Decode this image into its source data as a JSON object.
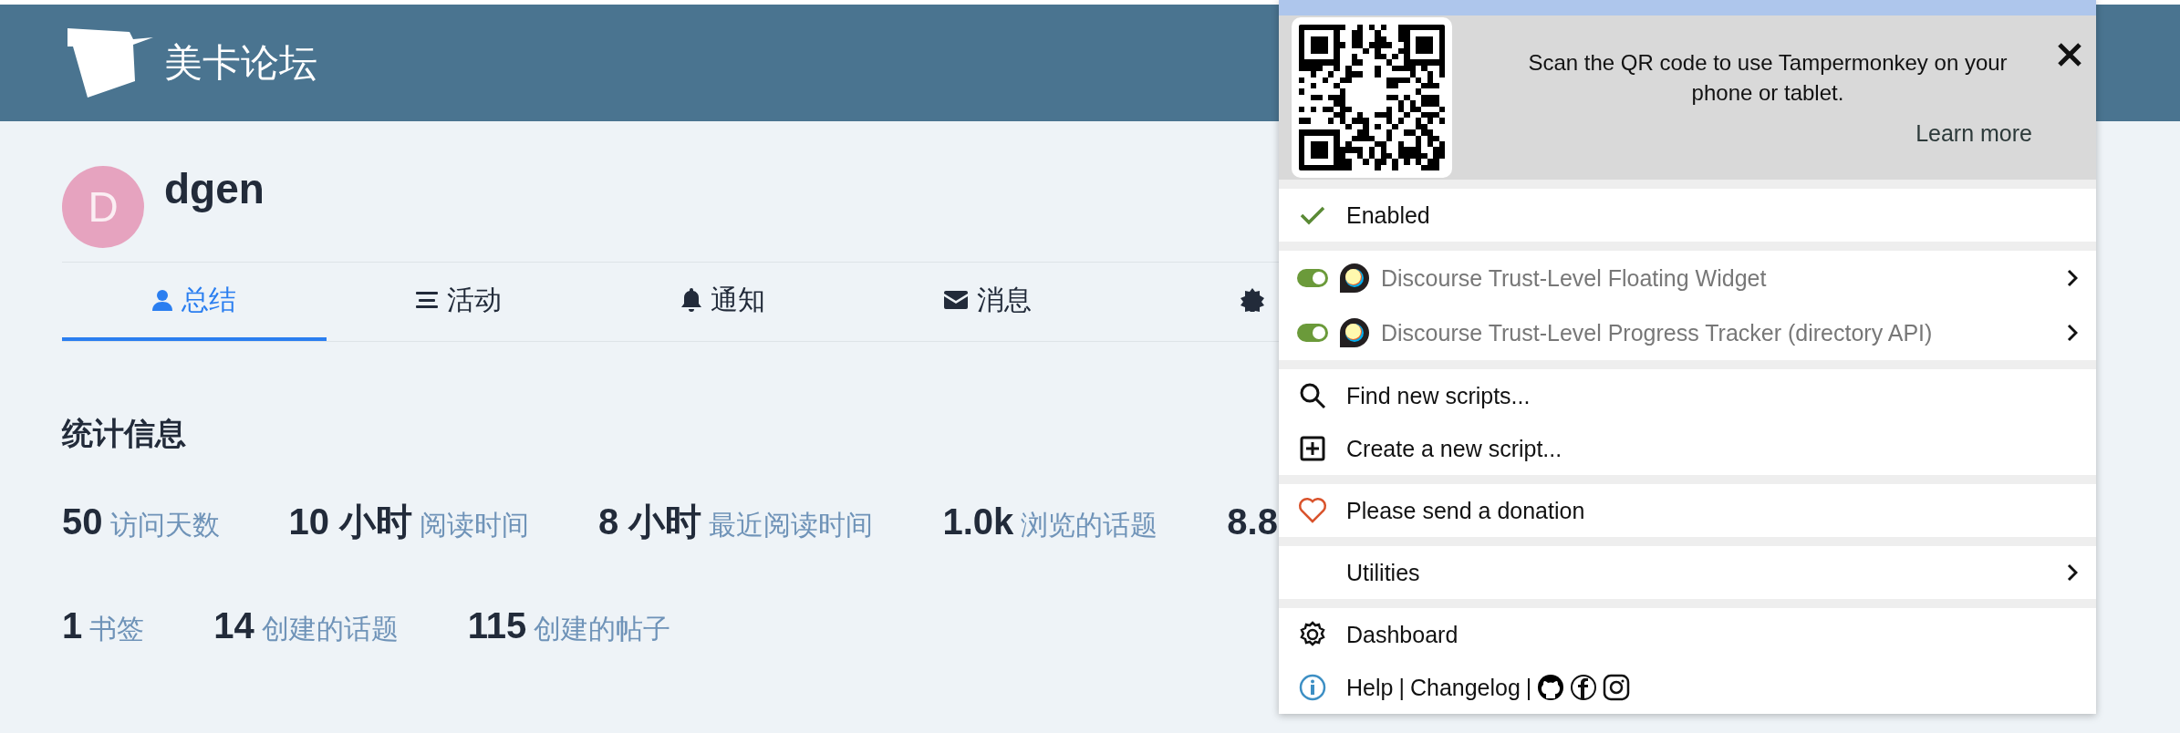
{
  "header": {
    "site_name": "美卡论坛"
  },
  "profile": {
    "avatar_letter": "D",
    "username": "dgen"
  },
  "tabs": [
    {
      "kind": "user",
      "label": "总结",
      "selected": true
    },
    {
      "kind": "activity",
      "label": "活动",
      "selected": false
    },
    {
      "kind": "notifications",
      "label": "通知",
      "selected": false
    },
    {
      "kind": "messages",
      "label": "消息",
      "selected": false
    },
    {
      "kind": "preferences",
      "selected": false
    }
  ],
  "stats": {
    "title": "统计信息",
    "rows": [
      [
        {
          "value": "50",
          "label": "访问天数"
        },
        {
          "value": "10 小时",
          "label": "阅读时间"
        },
        {
          "value": "8 小时",
          "label": "最近阅读时间"
        },
        {
          "value": "1.0k",
          "label": "浏览的话题"
        },
        {
          "value": "8.8"
        }
      ],
      [
        {
          "value": "1",
          "label": "书签"
        },
        {
          "value": "14",
          "label": "创建的话题"
        },
        {
          "value": "115",
          "label": "创建的帖子"
        }
      ]
    ]
  },
  "popup": {
    "qr_banner": {
      "text": "Scan the QR code to use Tampermonkey on your phone or tablet.",
      "link": "Learn more"
    },
    "enabled": {
      "label": "Enabled",
      "checked": true
    },
    "scripts": [
      {
        "name": "Discourse Trust-Level Floating Widget",
        "on": true
      },
      {
        "name": "Discourse Trust-Level Progress Tracker (directory API)",
        "on": true
      }
    ],
    "sections": [
      [
        {
          "kind": "search",
          "label": "Find new scripts..."
        },
        {
          "kind": "create",
          "label": "Create a new script..."
        }
      ],
      [
        {
          "kind": "donate",
          "label": "Please send a donation"
        }
      ],
      [
        {
          "kind": "submenu",
          "label": "Utilities"
        }
      ],
      [
        {
          "kind": "dashboard",
          "label": "Dashboard"
        },
        {
          "kind": "help",
          "links": [
            "Help",
            "|",
            "Changelog",
            "|"
          ]
        }
      ]
    ]
  }
}
